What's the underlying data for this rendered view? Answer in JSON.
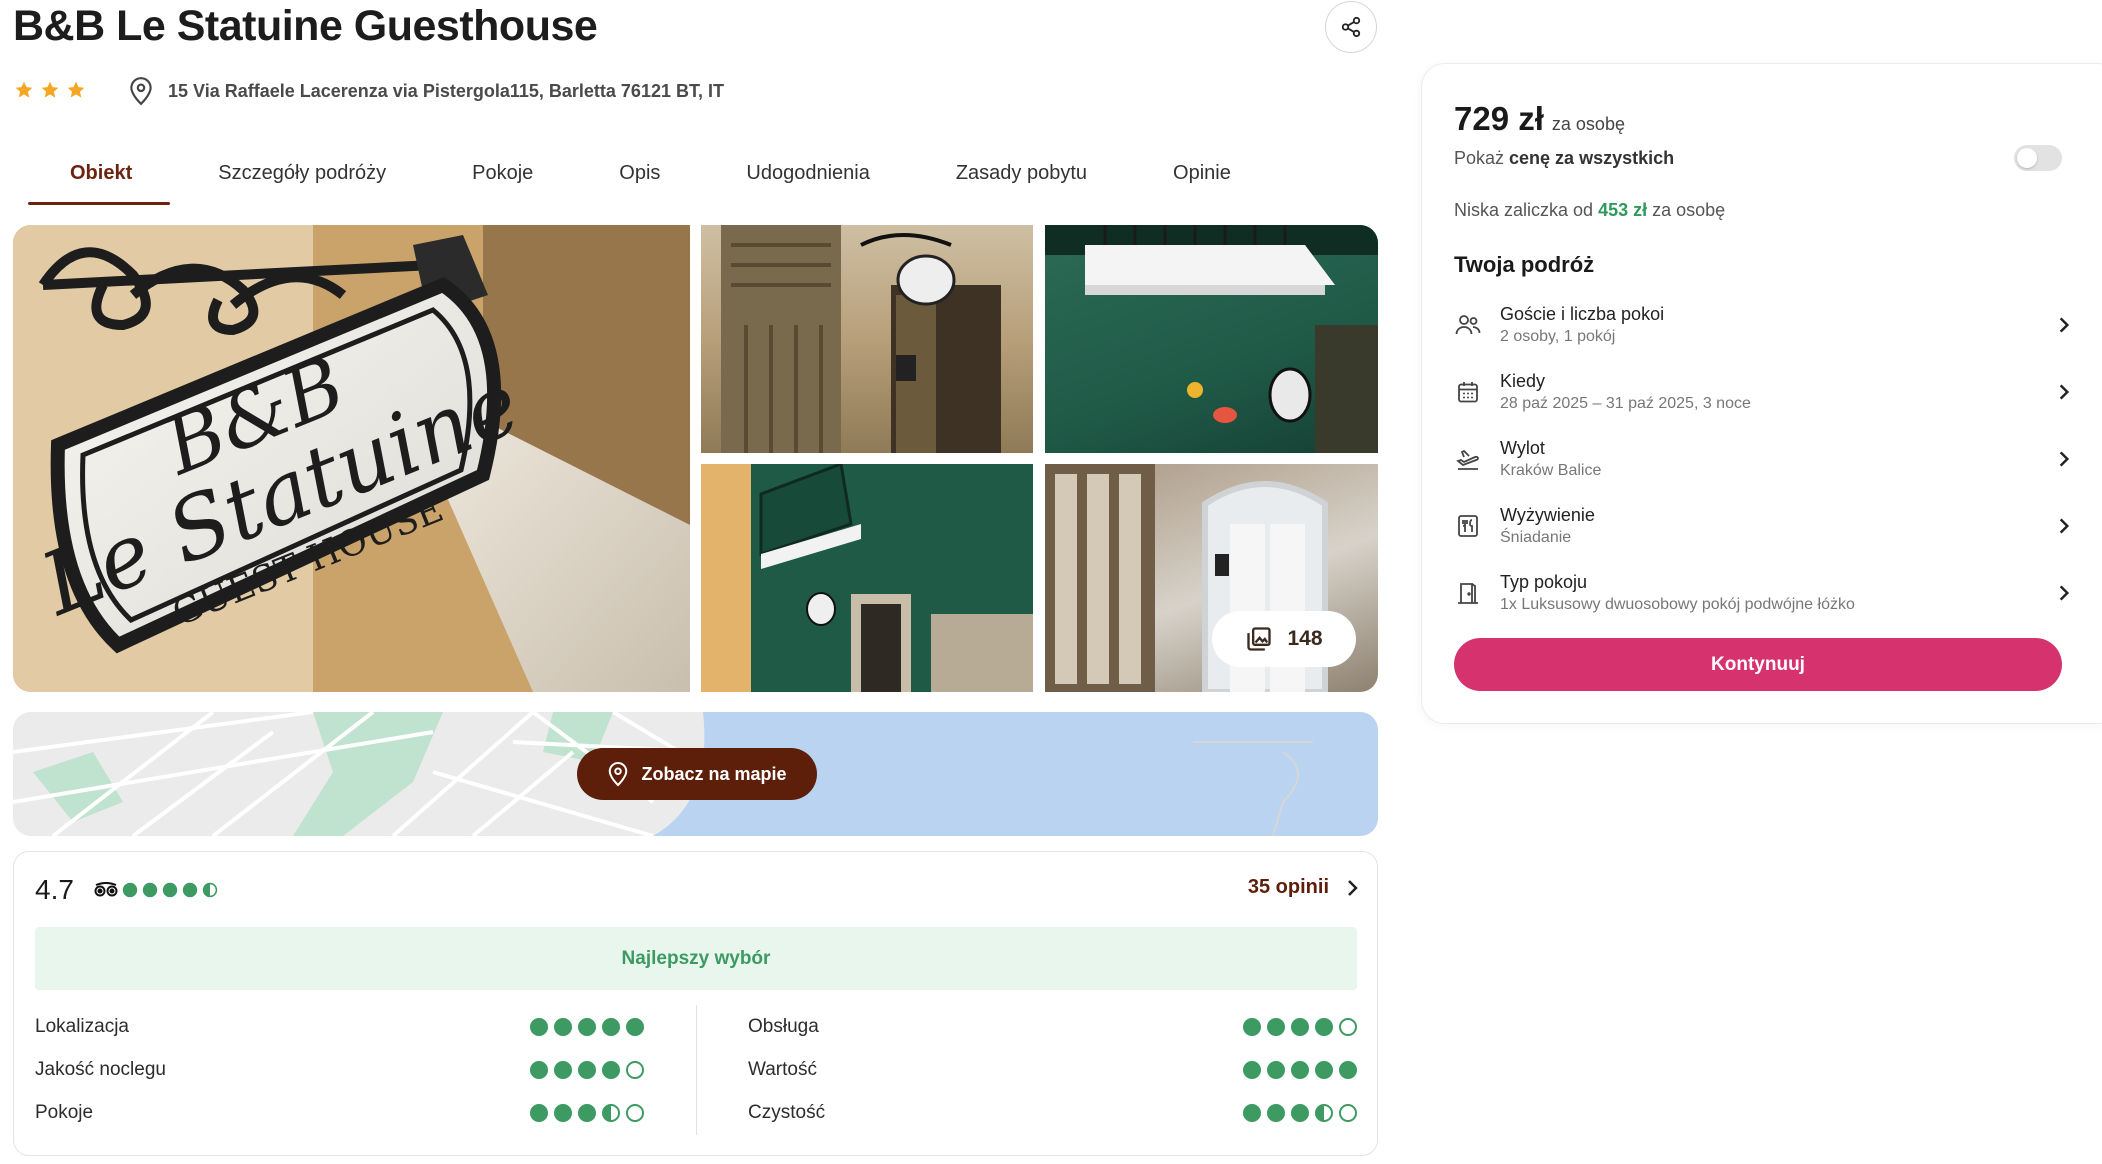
{
  "hotel": {
    "title": "B&B Le Statuine Guesthouse",
    "stars": 3,
    "address": "15 Via Raffaele Lacerenza via Pistergola115, Barletta 76121 BT, IT"
  },
  "tabs": [
    {
      "label": "Obiekt",
      "active": true
    },
    {
      "label": "Szczegóły podróży",
      "active": false
    },
    {
      "label": "Pokoje",
      "active": false
    },
    {
      "label": "Opis",
      "active": false
    },
    {
      "label": "Udogodnienia",
      "active": false
    },
    {
      "label": "Zasady pobytu",
      "active": false
    },
    {
      "label": "Opinie",
      "active": false
    }
  ],
  "gallery": {
    "photo_count": "148",
    "main_sign": {
      "line1": "B&B",
      "line2": "Le Statuine",
      "line3": "GUEST HOUSE"
    }
  },
  "map": {
    "button_label": "Zobacz na mapie"
  },
  "reviews": {
    "score": "4.7",
    "rating_dots": 4.5,
    "count_label": "35 opinii",
    "badge": "Najlepszy wybór",
    "categories_left": [
      {
        "label": "Lokalizacja",
        "rating": 5
      },
      {
        "label": "Jakość noclegu",
        "rating": 4
      },
      {
        "label": "Pokoje",
        "rating": 3.5
      }
    ],
    "categories_right": [
      {
        "label": "Obsługa",
        "rating": 4
      },
      {
        "label": "Wartość",
        "rating": 5
      },
      {
        "label": "Czystość",
        "rating": 3.5
      }
    ]
  },
  "booking": {
    "price": "729 zł",
    "price_unit": "za osobę",
    "show_all_prefix": "Pokaż ",
    "show_all_bold": "cenę za wszystkich",
    "deposit_prefix": "Niska zaliczka od ",
    "deposit_amount": "453 zł",
    "deposit_suffix": " za osobę",
    "trip_title": "Twoja podróż",
    "items": [
      {
        "icon": "guests-icon",
        "label": "Goście i liczba pokoi",
        "value": "2 osoby, 1 pokój"
      },
      {
        "icon": "calendar-icon",
        "label": "Kiedy",
        "value": "28 paź 2025 – 31 paź 2025, 3 noce"
      },
      {
        "icon": "plane-departure-icon",
        "label": "Wylot",
        "value": "Kraków Balice"
      },
      {
        "icon": "fork-knife-icon",
        "label": "Wyżywienie",
        "value": "Śniadanie"
      },
      {
        "icon": "door-icon",
        "label": "Typ pokoju",
        "value": "1x Luksusowy dwuosobowy pokój podwójne łóżko"
      }
    ],
    "continue_label": "Kontynuuj"
  },
  "colors": {
    "brand_brown": "#5d1f0a",
    "accent_pink": "#d6326d",
    "rating_green": "#3d9a62",
    "star_orange": "#f5a623"
  }
}
